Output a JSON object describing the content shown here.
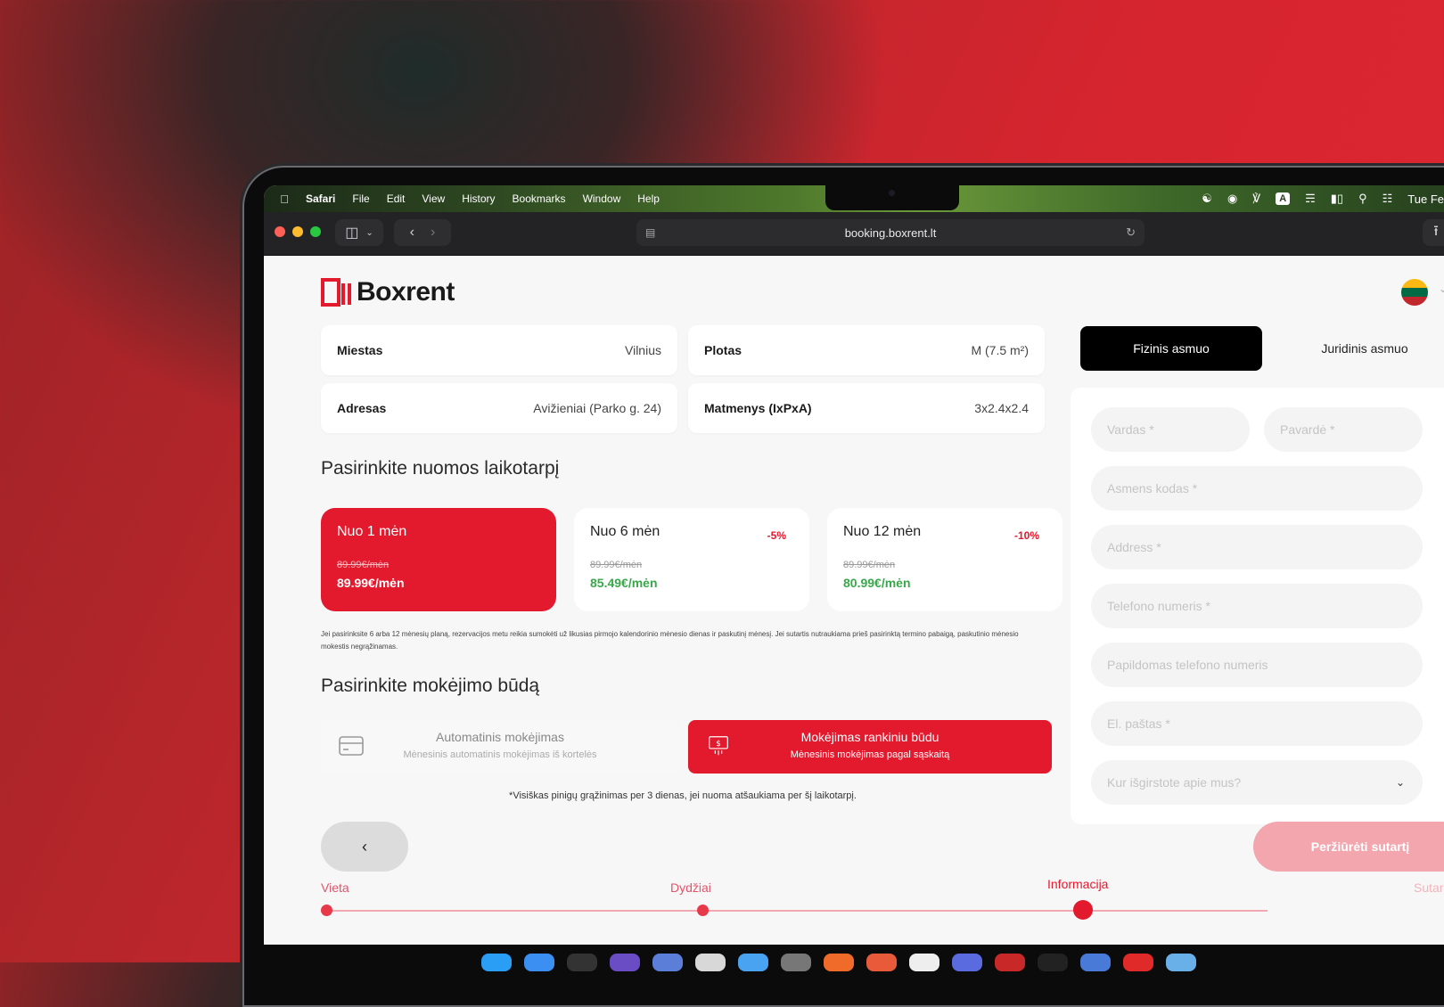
{
  "menubar": {
    "app": "Safari",
    "items": [
      "File",
      "Edit",
      "View",
      "History",
      "Bookmarks",
      "Window",
      "Help"
    ],
    "clock": "Tue Fe"
  },
  "browser": {
    "url": "booking.boxrent.lt"
  },
  "brand": {
    "name": "Boxrent",
    "color": "#e3192e"
  },
  "info": {
    "city_label": "Miestas",
    "city_value": "Vilnius",
    "area_label": "Plotas",
    "area_value": "M (7.5 m²)",
    "address_label": "Adresas",
    "address_value": "Avižieniai (Parko g. 24)",
    "dims_label": "Matmenys (IxPxA)",
    "dims_value": "3x2.4x2.4"
  },
  "period": {
    "heading": "Pasirinkite nuomos laikotarpį",
    "plans": [
      {
        "title": "Nuo 1 mėn",
        "discount": "",
        "old_price": "89.99€/mėn",
        "price": "89.99€/mėn",
        "selected": true
      },
      {
        "title": "Nuo 6 mėn",
        "discount": "-5%",
        "old_price": "89.99€/mėn",
        "price": "85.49€/mėn",
        "selected": false
      },
      {
        "title": "Nuo 12 mėn",
        "discount": "-10%",
        "old_price": "89.99€/mėn",
        "price": "80.99€/mėn",
        "selected": false
      }
    ],
    "note": "Jei pasirinksite 6 arba 12 mėnesių planą, rezervacijos metu reikia sumokėti už likusias pirmojo kalendorinio mėnesio dienas ir paskutinį mėnesį. Jei sutartis nutraukiama prieš pasirinktą termino pabaigą, paskutinio mėnesio mokestis negrąžinamas."
  },
  "payment": {
    "heading": "Pasirinkite mokėjimo būdą",
    "auto_title": "Automatinis mokėjimas",
    "auto_sub": "Mėnesinis automatinis mokėjimas iš kortelės",
    "manual_title": "Mokėjimas rankiniu būdu",
    "manual_sub": "Mėnesinis mokėjimas pagal sąskaitą",
    "refund_note": "*Visiškas pinigų grąžinimas per 3 dienas, jei nuoma atšaukiama per šį laikotarpį."
  },
  "customer": {
    "tab_private": "Fizinis asmuo",
    "tab_company": "Juridinis asmuo",
    "fields": {
      "first_name": "Vardas *",
      "last_name": "Pavardė *",
      "personal_code": "Asmens kodas *",
      "address": "Address *",
      "phone": "Telefono numeris *",
      "extra_phone": "Papildomas telefono numeris",
      "email": "El. paštas *",
      "source": "Kur išgirstote apie mus?"
    }
  },
  "nav": {
    "back": "‹",
    "next": "Peržiūrėti sutartį"
  },
  "steps": [
    "Vieta",
    "Dydžiai",
    "Informacija",
    "Sutar"
  ]
}
